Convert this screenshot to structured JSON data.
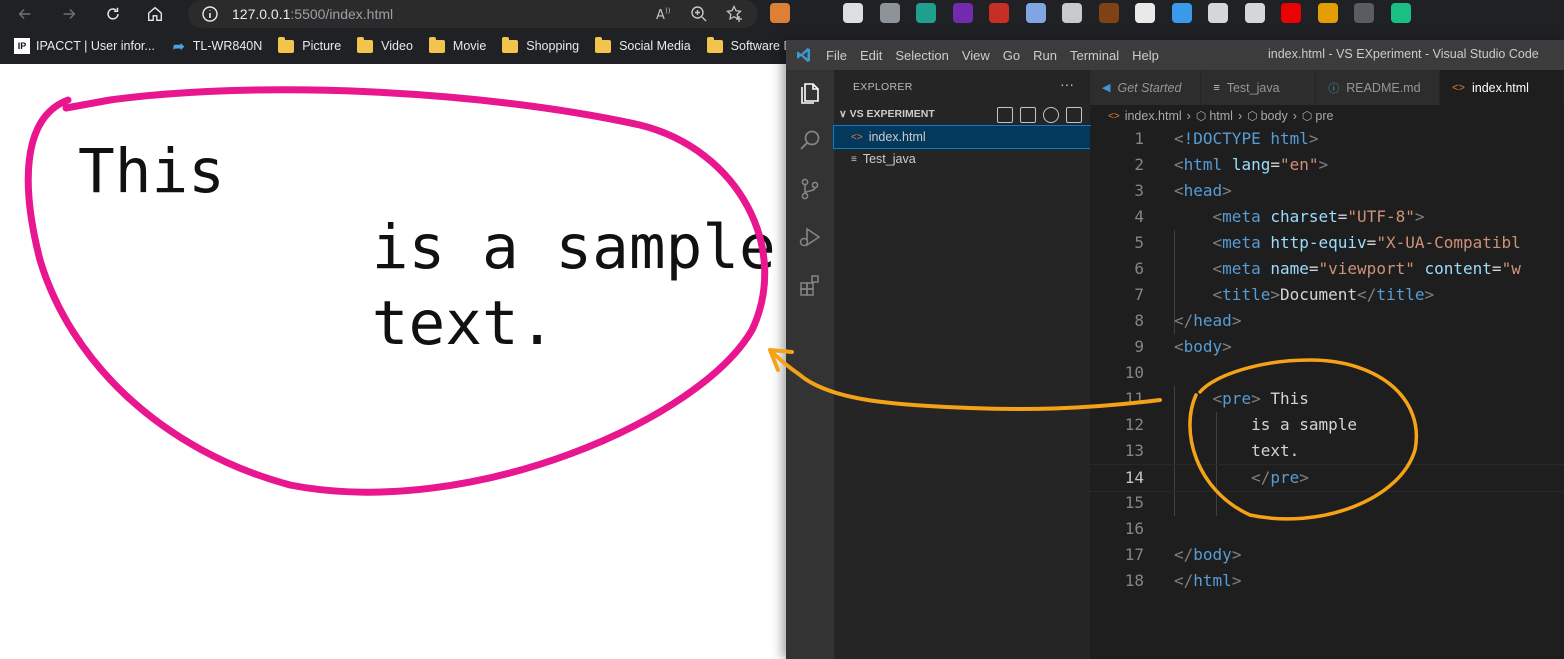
{
  "browser": {
    "url_host": "127.0.0.1",
    "url_path": ":5500/index.html",
    "extension_colors": [
      "#f28b39",
      "#5f6368",
      "#f1f3f4",
      "#9aa0a6",
      "#1fae9b",
      "#7b2cbf",
      "#d93025",
      "#8ab4f8",
      "#dadce0",
      "#8b4513",
      "#ffffff",
      "#3ea6ff",
      "#e8eaed",
      "#e8eaed",
      "#ff0000",
      "#f9ab00",
      "#5f6368",
      "#1ad18e"
    ]
  },
  "bookmarks": {
    "ip_icon_text": "IP",
    "items": [
      {
        "label": "IPACCT | User infor...",
        "icon": "ipacct-icon"
      },
      {
        "label": "TL-WR840N",
        "icon": "tplink-icon"
      },
      {
        "label": "Picture",
        "icon": "folder-icon"
      },
      {
        "label": "Video",
        "icon": "folder-icon"
      },
      {
        "label": "Movie",
        "icon": "folder-icon"
      },
      {
        "label": "Shopping",
        "icon": "folder-icon"
      },
      {
        "label": "Social Media",
        "icon": "folder-icon"
      },
      {
        "label": "Software Dow",
        "icon": "folder-icon"
      }
    ]
  },
  "page": {
    "lines": [
      "This",
      "        is a sample",
      "        text."
    ]
  },
  "annotation_colors": {
    "circle": "#e8168f",
    "arrow": "#f5a316"
  },
  "vscode": {
    "menu": [
      "File",
      "Edit",
      "Selection",
      "View",
      "Go",
      "Run",
      "Terminal",
      "Help"
    ],
    "window_title": "index.html - VS EXperiment - Visual Studio Code",
    "explorer_title": "EXPLORER",
    "explorer_more": "···",
    "folder_name": "VS EXPERIMENT",
    "folder_chevron": "∨",
    "files": [
      {
        "name": "index.html",
        "icon_glyph": "<>"
      },
      {
        "name": "Test_java",
        "icon_glyph": "≡"
      }
    ],
    "tabs": [
      {
        "label": "Get Started",
        "icon_glyph": "◀"
      },
      {
        "label": "Test_java",
        "icon_glyph": "≡"
      },
      {
        "label": "README.md",
        "icon_glyph": "ⓘ"
      },
      {
        "label": "index.html",
        "icon_glyph": "<>"
      }
    ],
    "breadcrumb": [
      "index.html",
      "html",
      "body",
      "pre"
    ],
    "current_line": 14,
    "code_lines": [
      {
        "n": "1",
        "text": "<!DOCTYPE html>"
      },
      {
        "n": "2",
        "text": "<html lang=\"en\">"
      },
      {
        "n": "3",
        "text": "<head>"
      },
      {
        "n": "4",
        "text": "    <meta charset=\"UTF-8\">"
      },
      {
        "n": "5",
        "text": "    <meta http-equiv=\"X-UA-Compatible"
      },
      {
        "n": "6",
        "text": "    <meta name=\"viewport\" content=\"wi"
      },
      {
        "n": "7",
        "text": "    <title>Document</title>"
      },
      {
        "n": "8",
        "text": "</head>"
      },
      {
        "n": "9",
        "text": "<body>"
      },
      {
        "n": "10",
        "text": ""
      },
      {
        "n": "11",
        "text": "    <pre> This"
      },
      {
        "n": "12",
        "text": "        is a sample"
      },
      {
        "n": "13",
        "text": "        text."
      },
      {
        "n": "14",
        "text": "        </pre>"
      },
      {
        "n": "15",
        "text": ""
      },
      {
        "n": "16",
        "text": ""
      },
      {
        "n": "17",
        "text": "</body>"
      },
      {
        "n": "18",
        "text": "</html>"
      }
    ]
  }
}
